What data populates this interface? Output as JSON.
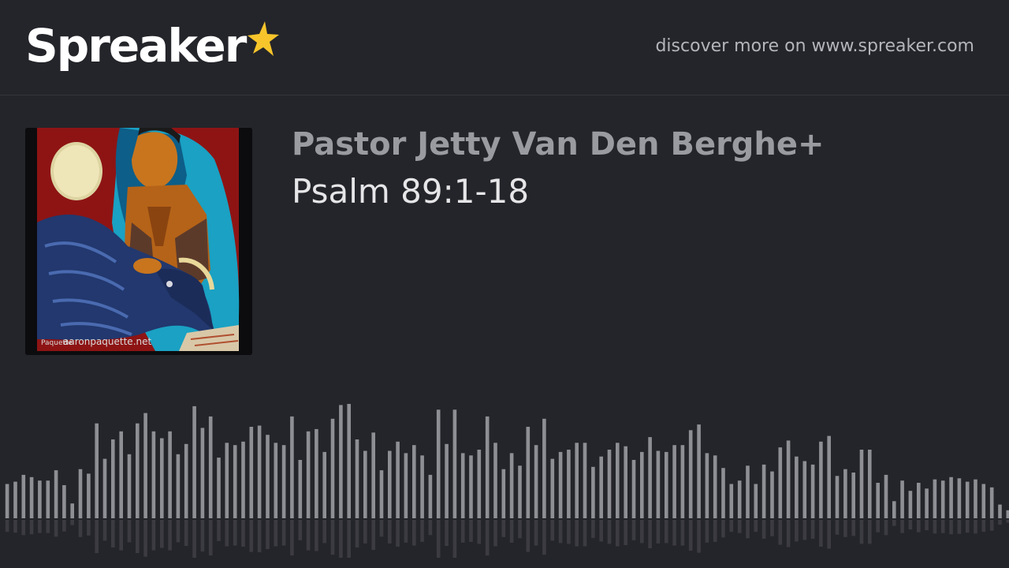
{
  "header": {
    "logo_text": "Spreaker",
    "discover_text": "discover more on www.spreaker.com"
  },
  "cover": {
    "watermark": "aaronpaquette.net",
    "signature": "Paquette"
  },
  "episode": {
    "show_title": "Pastor Jetty Van Den Berghe+",
    "episode_title": "Psalm 89:1-18"
  },
  "colors": {
    "background": "#24252a",
    "logo_star": "#f7c52b",
    "bar": "#8e8f94"
  },
  "icons": {
    "logo_star": "star-icon"
  },
  "waveform": {
    "levels": [
      0.3,
      0.32,
      0.38,
      0.36,
      0.33,
      0.33,
      0.42,
      0.29,
      0.13,
      0.43,
      0.39,
      0.83,
      0.52,
      0.69,
      0.76,
      0.56,
      0.83,
      0.92,
      0.76,
      0.7,
      0.76,
      0.56,
      0.65,
      0.98,
      0.79,
      0.89,
      0.53,
      0.66,
      0.64,
      0.67,
      0.8,
      0.81,
      0.73,
      0.66,
      0.64,
      0.89,
      0.51,
      0.76,
      0.78,
      0.58,
      0.87,
      0.99,
      1.0,
      0.69,
      0.59,
      0.75,
      0.42,
      0.59,
      0.67,
      0.57,
      0.64,
      0.55,
      0.38,
      0.95,
      0.65,
      0.95,
      0.57,
      0.55,
      0.6,
      0.89,
      0.66,
      0.43,
      0.57,
      0.46,
      0.8,
      0.64,
      0.87,
      0.52,
      0.58,
      0.6,
      0.66,
      0.66,
      0.45,
      0.54,
      0.6,
      0.66,
      0.63,
      0.51,
      0.58,
      0.71,
      0.59,
      0.58,
      0.64,
      0.64,
      0.77,
      0.82,
      0.57,
      0.55,
      0.44,
      0.3,
      0.33,
      0.46,
      0.3,
      0.47,
      0.41,
      0.62,
      0.68,
      0.54,
      0.5,
      0.47,
      0.67,
      0.72,
      0.37,
      0.43,
      0.4,
      0.6,
      0.6,
      0.31,
      0.38,
      0.15,
      0.33,
      0.24,
      0.31,
      0.26,
      0.34,
      0.33,
      0.36,
      0.35,
      0.32,
      0.34,
      0.3,
      0.27,
      0.12,
      0.07
    ]
  }
}
